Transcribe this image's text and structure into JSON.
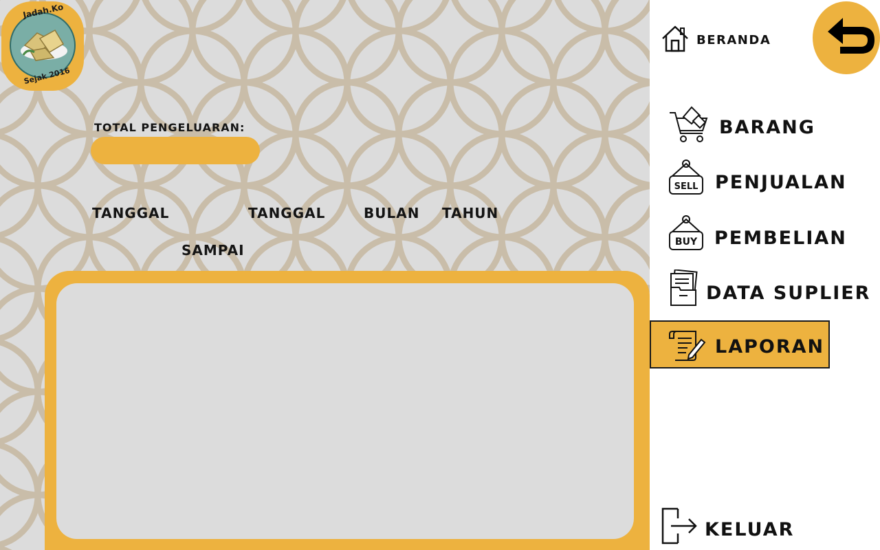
{
  "app": {
    "logo": {
      "brand_text": "Jadah.Ko",
      "since_text": "Sejak 2016"
    }
  },
  "form": {
    "total_label": "TOTAL PENGELUARAN:",
    "total_value": "",
    "date_from_label": "TANGGAL",
    "date_to_label": "TANGGAL",
    "until_label": "SAMPAI",
    "month_label": "BULAN",
    "year_label": "TAHUN"
  },
  "sidebar": {
    "home_label": "BERANDA",
    "items": [
      {
        "label": "BARANG",
        "icon": "cart-icon"
      },
      {
        "label": "PENJUALAN",
        "icon": "sell-tag-icon"
      },
      {
        "label": "PEMBELIAN",
        "icon": "buy-tag-icon"
      },
      {
        "label": "DATA SUPLIER",
        "icon": "folder-icon"
      },
      {
        "label": "LAPORAN",
        "icon": "report-scroll-icon",
        "active": true
      }
    ],
    "logout_label": "KELUAR"
  },
  "colors": {
    "accent": "#edb23f",
    "background": "#dcdcdc",
    "pattern": "#c9bda9",
    "sidebar": "#ffffff",
    "text": "#141414"
  }
}
